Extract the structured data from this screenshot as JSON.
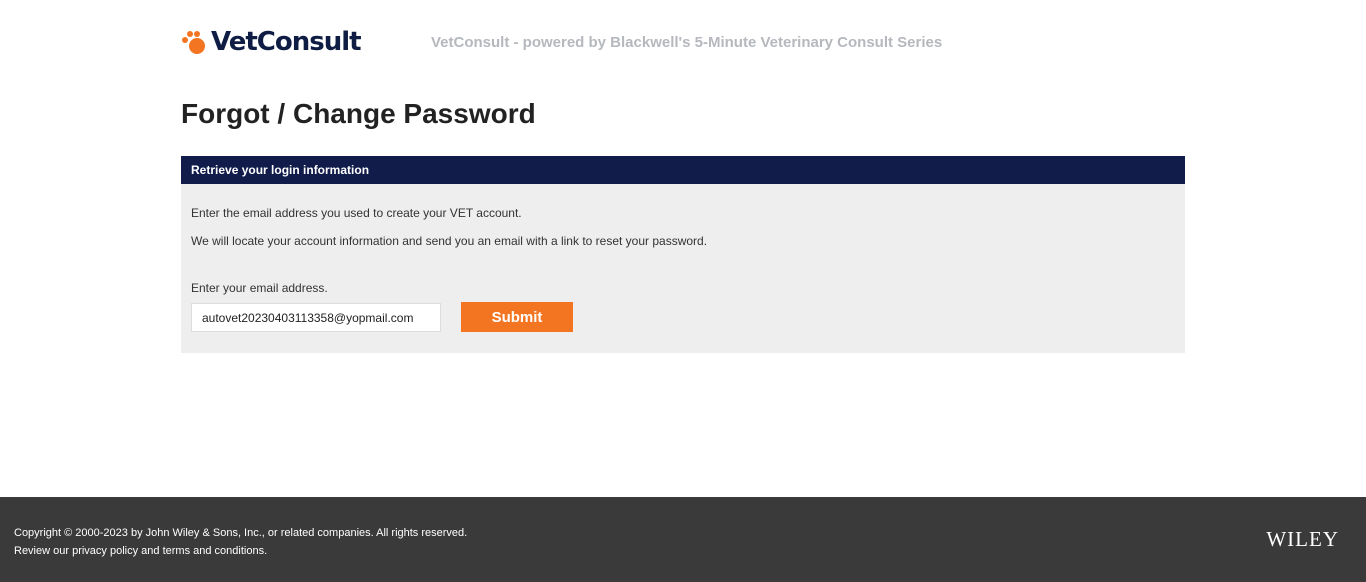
{
  "header": {
    "logo_text": "VetConsult",
    "tagline": "VetConsult - powered by Blackwell's 5-Minute Veterinary Consult Series"
  },
  "page": {
    "title": "Forgot / Change Password"
  },
  "panel": {
    "header": "Retrieve your login information",
    "line1": "Enter the email address you used to create your VET account.",
    "line2": "We will locate your account information and send you an email with a link to reset your password.",
    "email_label": "Enter your email address.",
    "email_value": "autovet20230403113358@yopmail.com",
    "submit_label": "Submit"
  },
  "footer": {
    "copyright": "Copyright © 2000-2023 by John Wiley & Sons, Inc., or related companies. All rights reserved.",
    "links_prefix": "Review our ",
    "privacy_label": "privacy policy",
    "links_and": " and ",
    "terms_label": "terms and conditions",
    "links_suffix": ".",
    "brand": "WILEY"
  },
  "colors": {
    "accent": "#f47521",
    "navy": "#111c4a",
    "panel_bg": "#eeeeee",
    "footer_bg": "#3a3a3a"
  },
  "icons": {
    "logo_icon": "paw-icon"
  }
}
